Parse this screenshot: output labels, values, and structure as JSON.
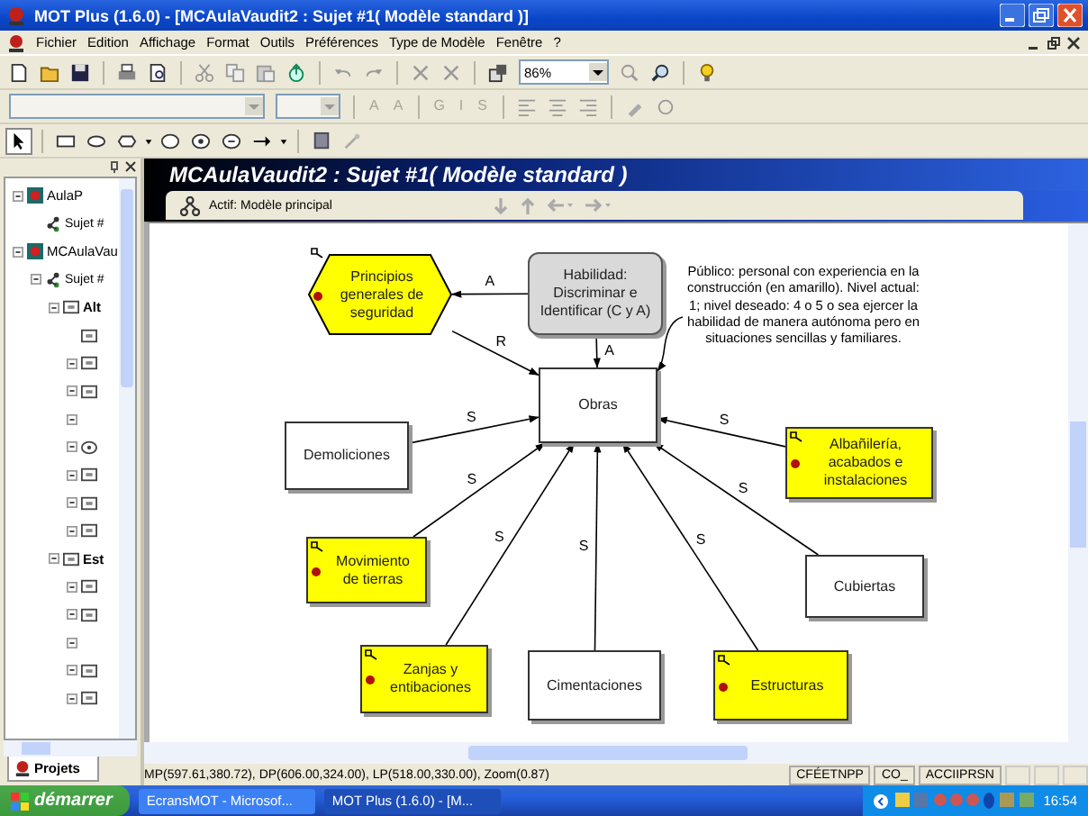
{
  "window": {
    "title": "MOT Plus (1.6.0) - [MCAulaVaudit2 : Sujet #1( Modèle standard )]"
  },
  "menu": [
    "Fichier",
    "Edition",
    "Affichage",
    "Format",
    "Outils",
    "Préférences",
    "Type de Modèle",
    "Fenêtre",
    "?"
  ],
  "toolbar": {
    "zoom": "86%"
  },
  "format_toolbar": [
    {
      "label": "A",
      "disabled": true
    },
    {
      "label": "A",
      "disabled": true
    },
    {
      "label": "G",
      "disabled": true
    },
    {
      "label": "I",
      "disabled": true
    },
    {
      "label": "S",
      "disabled": true
    }
  ],
  "tree": [
    {
      "label": "AulaP",
      "kind": "project",
      "expanded": true,
      "children": [
        {
          "label": "Sujet #",
          "kind": "subject"
        }
      ]
    },
    {
      "label": "MCAulaVau",
      "kind": "project",
      "expanded": true,
      "children": [
        {
          "label": "Sujet #",
          "kind": "subject",
          "expanded": true,
          "children": [
            {
              "label": "Alt",
              "kind": "concept",
              "expanded": true,
              "children": [
                {
                  "kind": "concept"
                },
                {
                  "kind": "concept",
                  "expanded": true
                },
                {
                  "kind": "concept",
                  "expanded": true
                },
                {
                  "kind": "leaf",
                  "expanded": true
                },
                {
                  "kind": "procedure",
                  "expanded": true
                },
                {
                  "kind": "concept",
                  "expanded": true
                },
                {
                  "kind": "concept",
                  "expanded": true
                },
                {
                  "kind": "concept",
                  "expanded": true
                }
              ]
            },
            {
              "label": "Est",
              "kind": "concept",
              "expanded": true,
              "children": [
                {
                  "kind": "concept",
                  "expanded": true
                },
                {
                  "kind": "concept",
                  "expanded": true
                },
                {
                  "kind": "leaf",
                  "expanded": true
                },
                {
                  "kind": "concept",
                  "expanded": true
                },
                {
                  "kind": "concept",
                  "expanded": true
                }
              ]
            }
          ]
        }
      ]
    }
  ],
  "left_tab": "Projets",
  "document": {
    "title": "MCAulaVaudit2 : Sujet #1( Modèle standard )",
    "active": "Actif: Modèle principal"
  },
  "diagram": {
    "nodes": [
      {
        "kind": "principle",
        "label": "Principios generales de seguridad",
        "highlighted": true
      },
      {
        "kind": "skill",
        "label": "Habilidad: Discriminar e Identificar (C y A)",
        "highlighted": false
      },
      {
        "kind": "concept",
        "label": "Obras",
        "highlighted": false
      },
      {
        "kind": "concept",
        "label": "Demoliciones",
        "highlighted": false
      },
      {
        "kind": "concept",
        "label": "Albañilería, acabados e instalaciones",
        "highlighted": true
      },
      {
        "kind": "concept",
        "label": "Movimiento de tierras",
        "highlighted": true
      },
      {
        "kind": "concept",
        "label": "Cubiertas",
        "highlighted": false
      },
      {
        "kind": "concept",
        "label": "Zanjas y entibaciones",
        "highlighted": true
      },
      {
        "kind": "concept",
        "label": "Cimentaciones",
        "highlighted": false
      },
      {
        "kind": "concept",
        "label": "Estructuras",
        "highlighted": true
      }
    ],
    "links": [
      {
        "label": "A"
      },
      {
        "label": "A"
      },
      {
        "label": "R"
      },
      {
        "label": "S"
      },
      {
        "label": "S"
      },
      {
        "label": "S"
      },
      {
        "label": "S"
      },
      {
        "label": "S"
      },
      {
        "label": "S"
      },
      {
        "label": "S"
      }
    ],
    "note": "Público: personal con experiencia en la construcción (en amarillo). Nivel actual: 1; nivel deseado: 4 o 5 o sea  ejercer la habilidad de manera autónoma pero en situaciones sencillas y familiares."
  },
  "status_bar": {
    "position": "MP(597.61,380.72), DP(606.00,324.00), LP(518.00,330.00), Zoom(0.87)",
    "fields": [
      "CFÉETNPP",
      "CO_",
      "ACCIIPRSN"
    ]
  },
  "taskbar": {
    "start": "démarrer",
    "tasks": [
      {
        "label": "EcransMOT - Microsof...",
        "selected": false
      },
      {
        "label": "MOT Plus (1.6.0) - [M...",
        "selected": true
      }
    ],
    "clock": "16:54"
  }
}
